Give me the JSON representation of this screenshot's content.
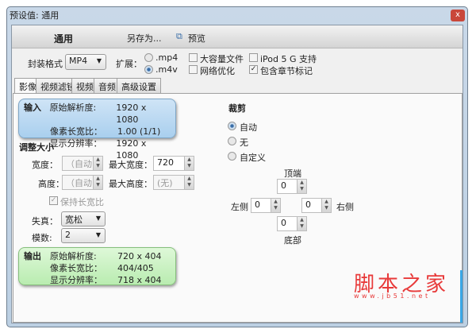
{
  "window": {
    "title": "预设值: 通用",
    "close": "x"
  },
  "toolbar": {
    "preset": "通用",
    "save_as": "另存为...",
    "preview": "预览"
  },
  "options": {
    "container_label": "封装格式",
    "container_value": "MP4",
    "ext_label": "扩展：",
    "ext_mp4": ".mp4",
    "ext_m4v": ".m4v",
    "large_file": "大容量文件",
    "web_opt": "网络优化",
    "ipod": "iPod 5 G 支持",
    "chapters": "包含章节标记"
  },
  "tabs": [
    "影像",
    "视频滤镜",
    "视频",
    "音频",
    "高级设置"
  ],
  "input": {
    "tag": "输入",
    "labels": [
      "原始解析度:",
      "像素长宽比：",
      "显示分辨率："
    ],
    "values": [
      "1920 x 1080",
      "1.00 (1/1)",
      "1920 x 1080"
    ]
  },
  "resize": {
    "title": "调整大小",
    "width_label": "宽度：",
    "width_value": "（自动",
    "max_width_label": "最大宽度：",
    "max_width_value": "720",
    "height_label": "高度：",
    "height_value": "（自动",
    "max_height_label": "最大高度：",
    "max_height_value": "(无)",
    "keep_aspect": "保持长宽比",
    "anamorphic_label": "失真：",
    "anamorphic_value": "宽松",
    "modulus_label": "模数:",
    "modulus_value": "2"
  },
  "output": {
    "tag": "输出",
    "labels": [
      "原始解析度:",
      "像素长宽比：",
      "显示分辨率："
    ],
    "values": [
      "720 x 404",
      "404/405",
      "718 x 404"
    ]
  },
  "crop": {
    "title": "裁剪",
    "modes": [
      "自动",
      "无",
      "自定义"
    ],
    "top": "顶端",
    "bottom": "底部",
    "left": "左侧",
    "right": "右侧",
    "top_value": "0",
    "bottom_value": "0",
    "left_value": "0",
    "right_value": "0"
  },
  "watermark": {
    "text": "脚本之家",
    "url": "www.jb51.net"
  }
}
